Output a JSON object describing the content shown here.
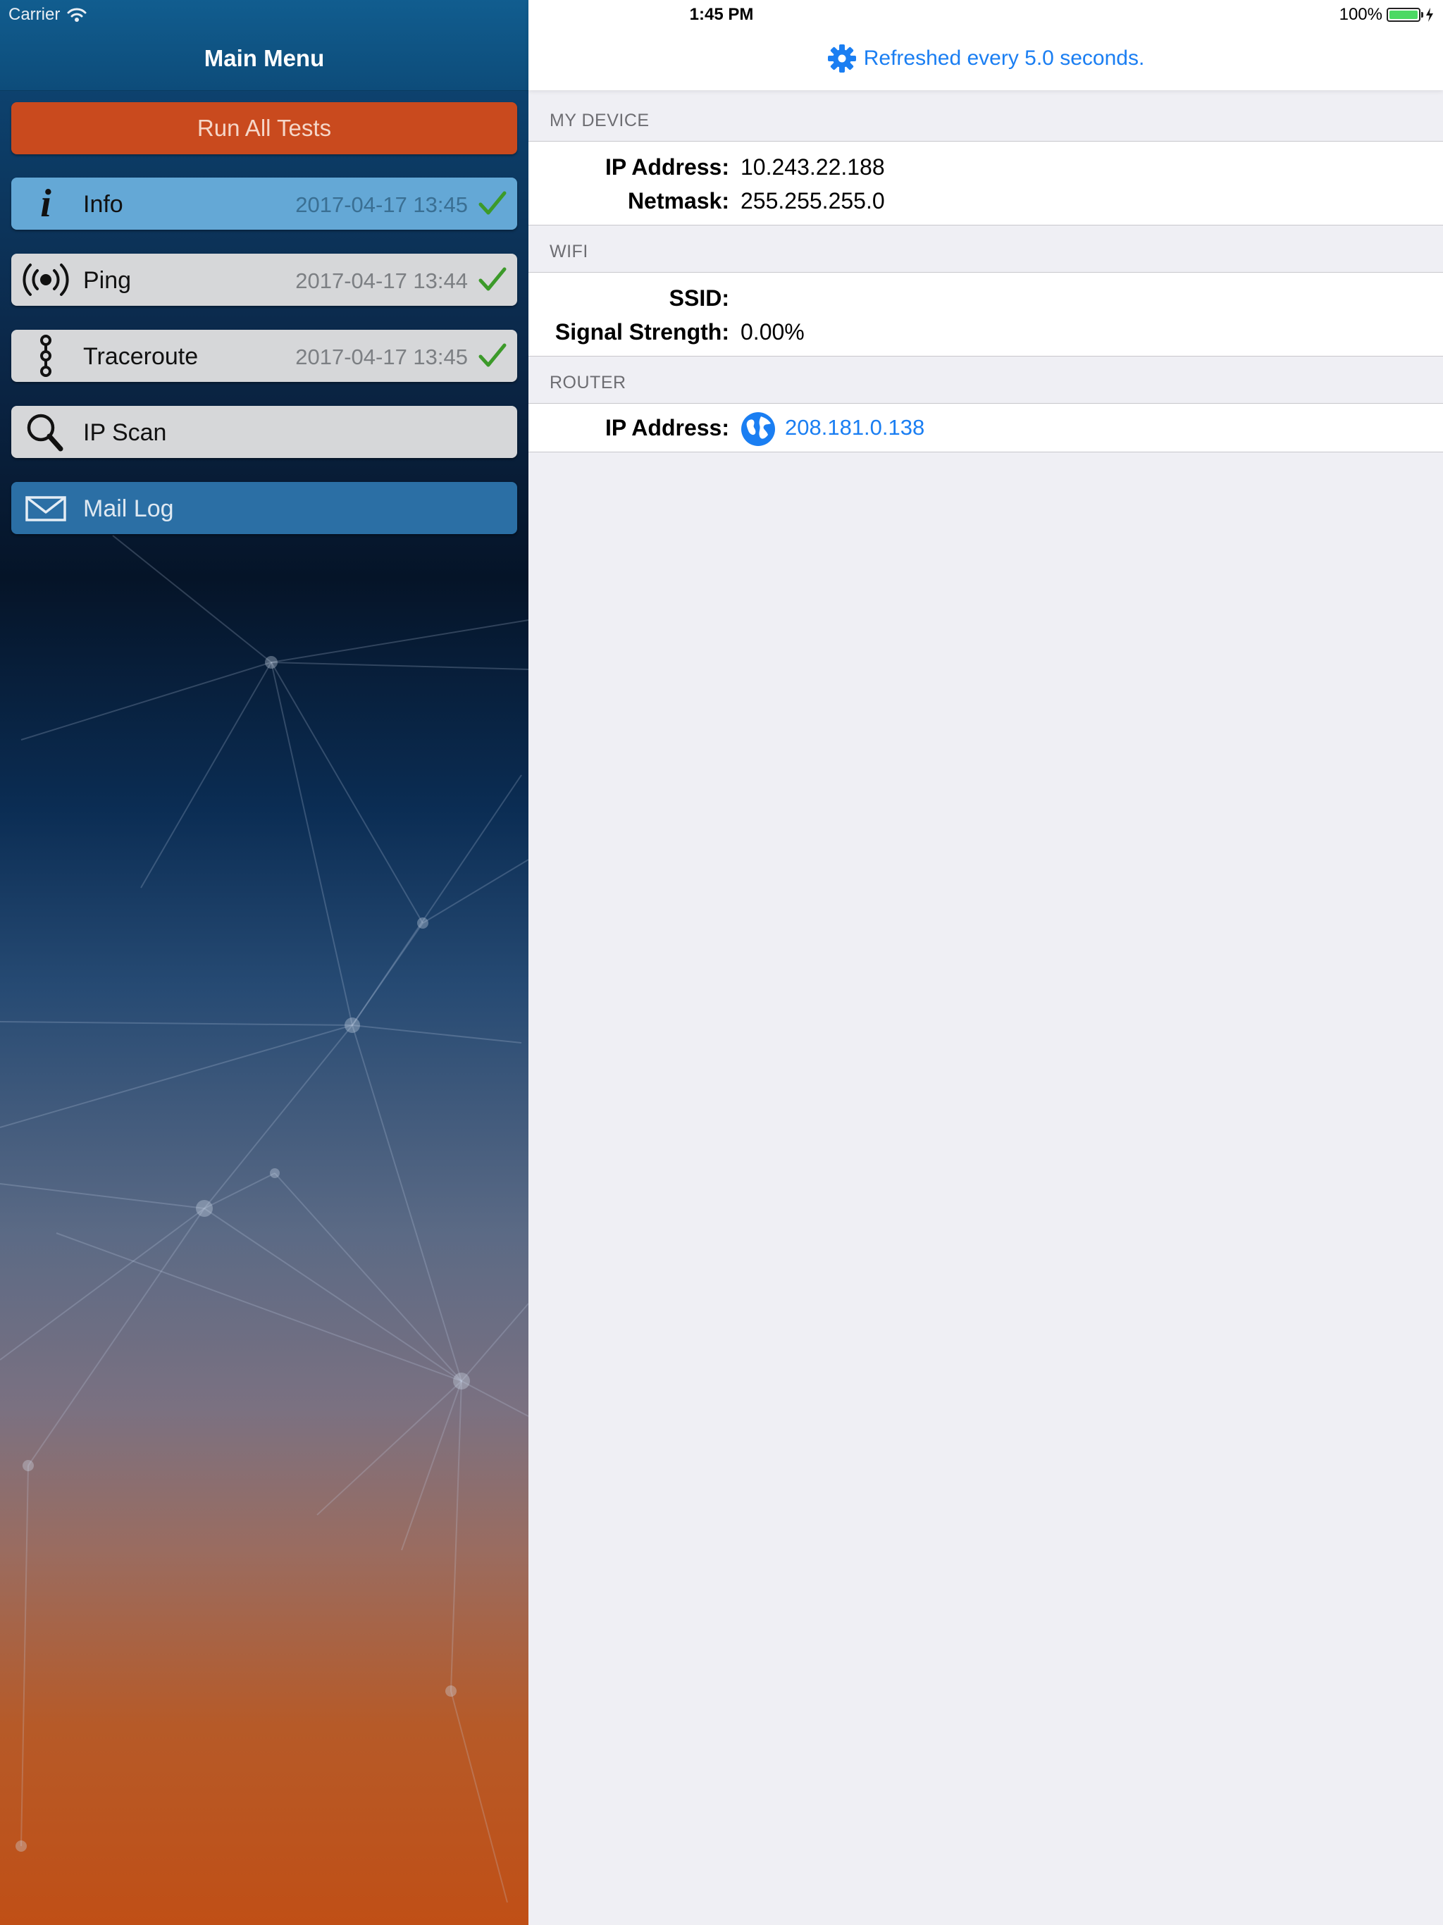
{
  "status_bar": {
    "carrier": "Carrier",
    "time": "1:45 PM",
    "battery": "100%",
    "battery_level": 1.0
  },
  "left_panel": {
    "title": "Main Menu",
    "run_all_label": "Run All Tests",
    "items": [
      {
        "label": "Info",
        "timestamp": "2017-04-17 13:45",
        "icon": "info-icon",
        "checked": true
      },
      {
        "label": "Ping",
        "timestamp": "2017-04-17 13:44",
        "icon": "broadcast-icon",
        "checked": true
      },
      {
        "label": "Traceroute",
        "timestamp": "2017-04-17 13:45",
        "icon": "route-icon",
        "checked": true
      },
      {
        "label": "IP Scan",
        "timestamp": "",
        "icon": "magnifier-icon",
        "checked": false
      },
      {
        "label": "Mail Log",
        "timestamp": "",
        "icon": "envelope-icon",
        "checked": false
      }
    ]
  },
  "right_panel": {
    "refresh_text": "Refreshed every 5.0 seconds.",
    "sections": {
      "my_device": {
        "header": "MY DEVICE",
        "ip_label": "IP Address:",
        "ip_value": "10.243.22.188",
        "netmask_label": "Netmask:",
        "netmask_value": "255.255.255.0"
      },
      "wifi": {
        "header": "WIFI",
        "ssid_label": "SSID:",
        "ssid_value": "",
        "signal_label": "Signal Strength:",
        "signal_value": "0.00%"
      },
      "router": {
        "header": "ROUTER",
        "ip_label": "IP Address:",
        "ip_value": "208.181.0.138"
      }
    }
  },
  "colors": {
    "accent_blue": "#1a7ef2",
    "run_button": "#c94a1e",
    "active_item": "#64a8d6",
    "mail_item": "#2b6fa5",
    "check_green": "#3c9a2a"
  }
}
